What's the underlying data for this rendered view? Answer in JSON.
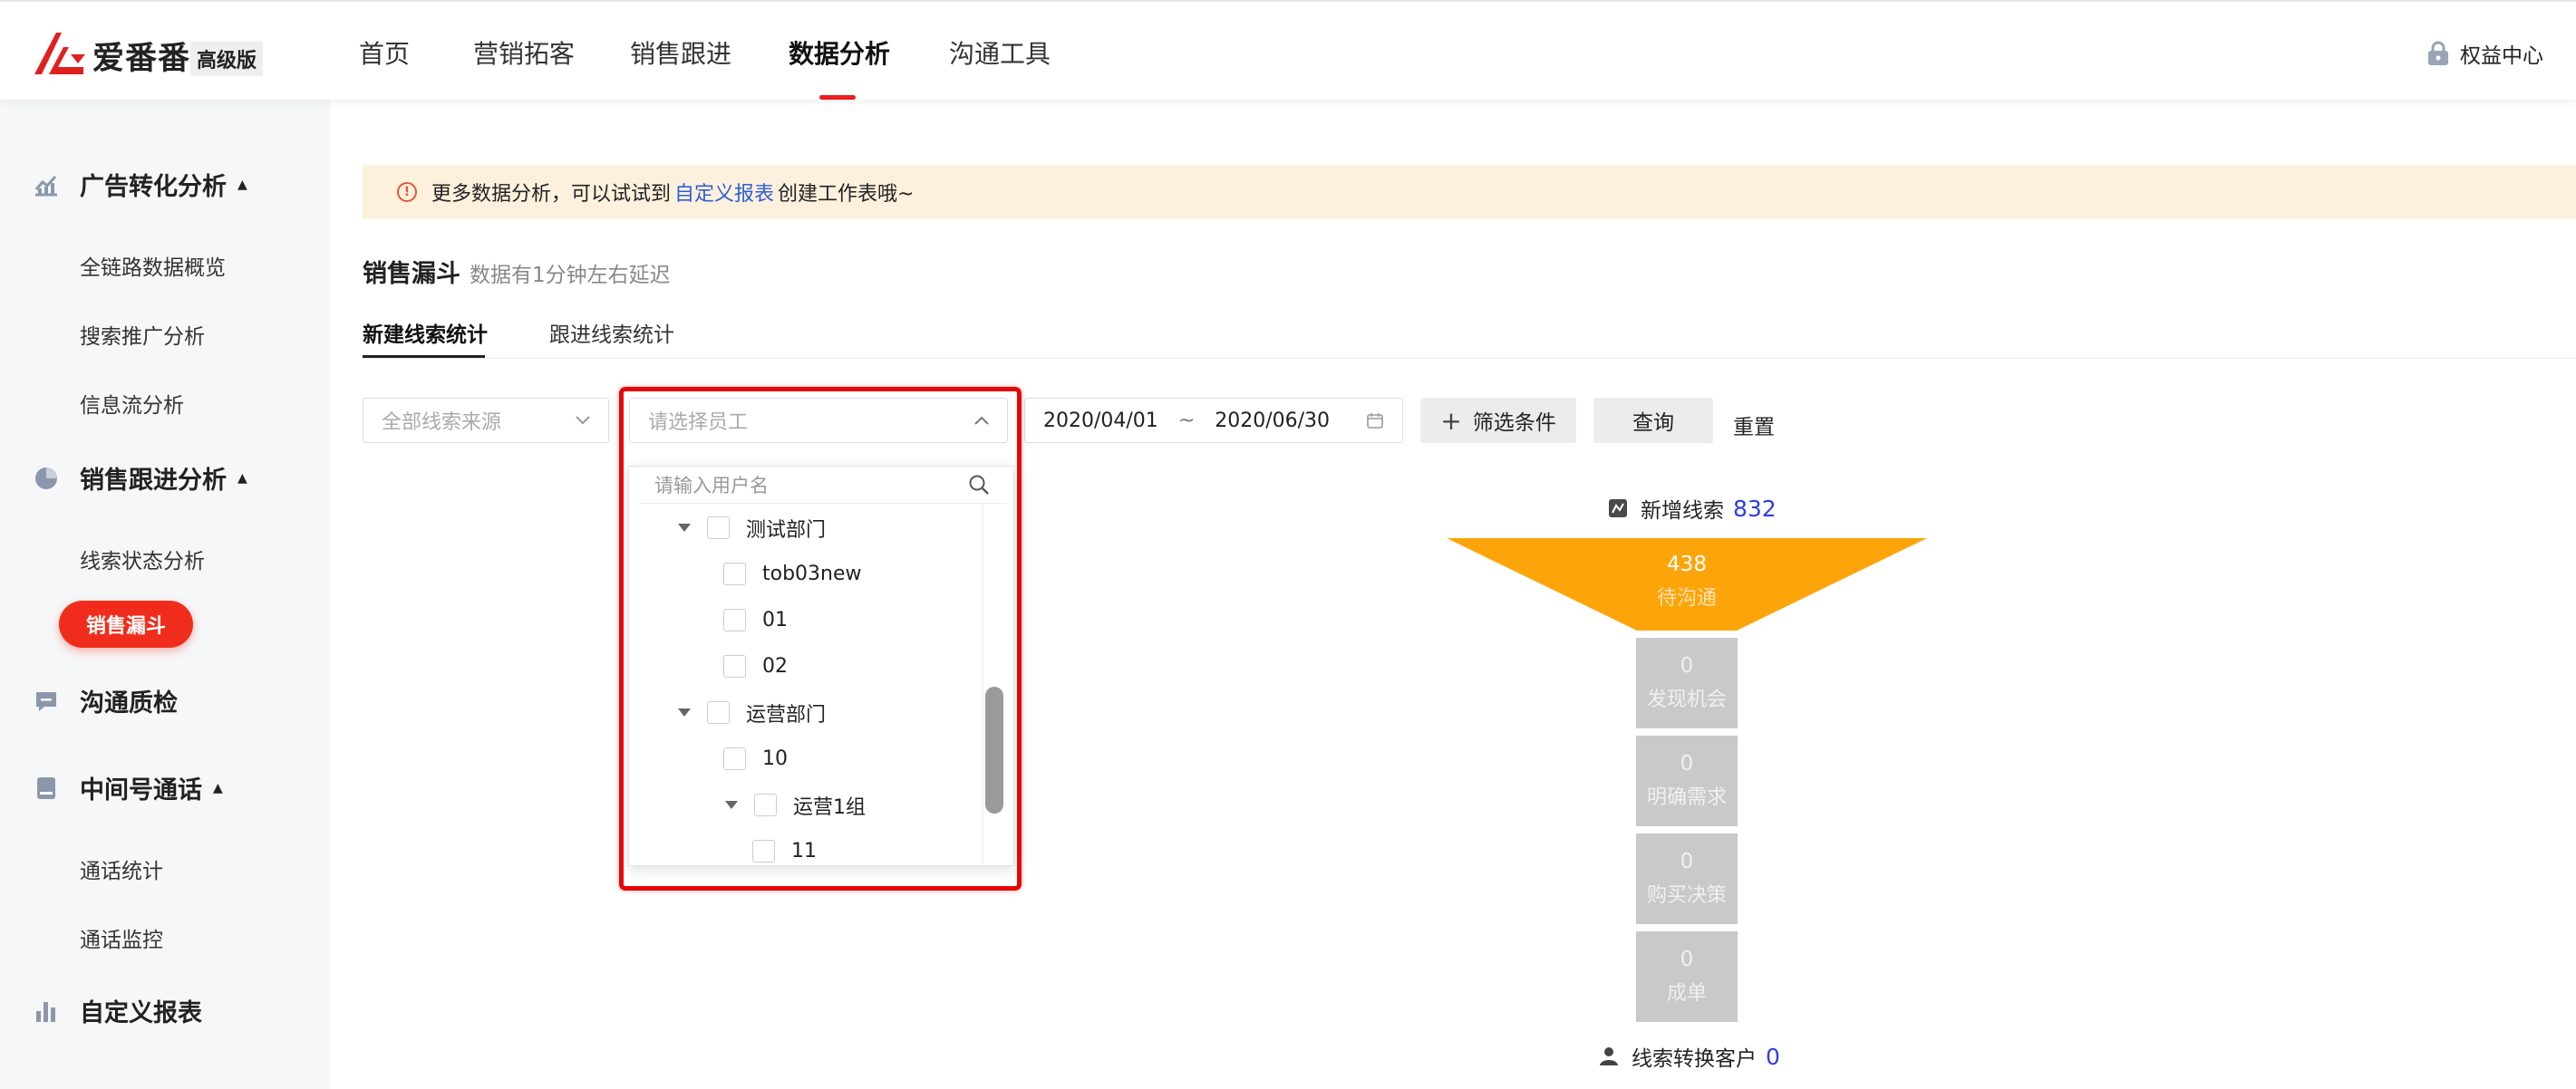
{
  "brand": {
    "name": "爱番番",
    "badge": "高级版"
  },
  "nav": {
    "items": [
      "首页",
      "营销拓客",
      "销售跟进",
      "数据分析",
      "沟通工具"
    ],
    "active": "数据分析"
  },
  "header_right": {
    "label": "权益中心",
    "icon": "lock-icon"
  },
  "sidebar": {
    "sections": [
      {
        "label": "广告转化分析",
        "icon": "trend-chart-icon",
        "items": [
          "全链路数据概览",
          "搜索推广分析",
          "信息流分析"
        ]
      },
      {
        "label": "销售跟进分析",
        "icon": "pie-chart-icon",
        "items": [
          "线索状态分析",
          "销售漏斗"
        ]
      },
      {
        "label": "沟通质检",
        "icon": "chat-icon",
        "items": []
      },
      {
        "label": "中间号通话",
        "icon": "phone-book-icon",
        "items": [
          "通话统计",
          "通话监控"
        ]
      },
      {
        "label": "自定义报表",
        "icon": "bar-chart-icon",
        "items": []
      }
    ],
    "active_item": "销售漏斗"
  },
  "notice": {
    "prefix": "更多数据分析，可以试试到",
    "link": "自定义报表",
    "suffix": "创建工作表哦~"
  },
  "section": {
    "title": "销售漏斗",
    "note": "数据有1分钟左右延迟"
  },
  "tabs": [
    "新建线索统计",
    "跟进线索统计"
  ],
  "filters": {
    "source_placeholder": "全部线索来源",
    "employee_placeholder": "请选择员工",
    "date_start": "2020/04/01",
    "date_sep": "~",
    "date_end": "2020/06/30",
    "filter_button": "筛选条件",
    "query_button": "查询",
    "reset_button": "重置"
  },
  "employee_dropdown": {
    "search_placeholder": "请输入用户名",
    "tree": [
      {
        "label": "测试部门",
        "level": 0,
        "expandable": true
      },
      {
        "label": "tob03new",
        "level": 1,
        "expandable": false
      },
      {
        "label": "01",
        "level": 1,
        "expandable": false
      },
      {
        "label": "02",
        "level": 1,
        "expandable": false
      },
      {
        "label": "运营部门",
        "level": 0,
        "expandable": true
      },
      {
        "label": "10",
        "level": 1,
        "expandable": false
      },
      {
        "label": "运营1组",
        "level": 1,
        "expandable": true
      },
      {
        "label": "11",
        "level": 2,
        "expandable": false
      }
    ]
  },
  "funnel": {
    "leads_label": "新增线索",
    "leads_value": "832",
    "stages": [
      {
        "value": "438",
        "label": "待沟通"
      },
      {
        "value": "0",
        "label": "发现机会"
      },
      {
        "value": "0",
        "label": "明确需求"
      },
      {
        "value": "0",
        "label": "购买决策"
      },
      {
        "value": "0",
        "label": "成单"
      }
    ],
    "converted_label": "线索转换客户",
    "converted_value": "0",
    "colors": {
      "top": "#fca50a",
      "stage": "#c9c9c9",
      "number": "#2d3fe0"
    }
  }
}
